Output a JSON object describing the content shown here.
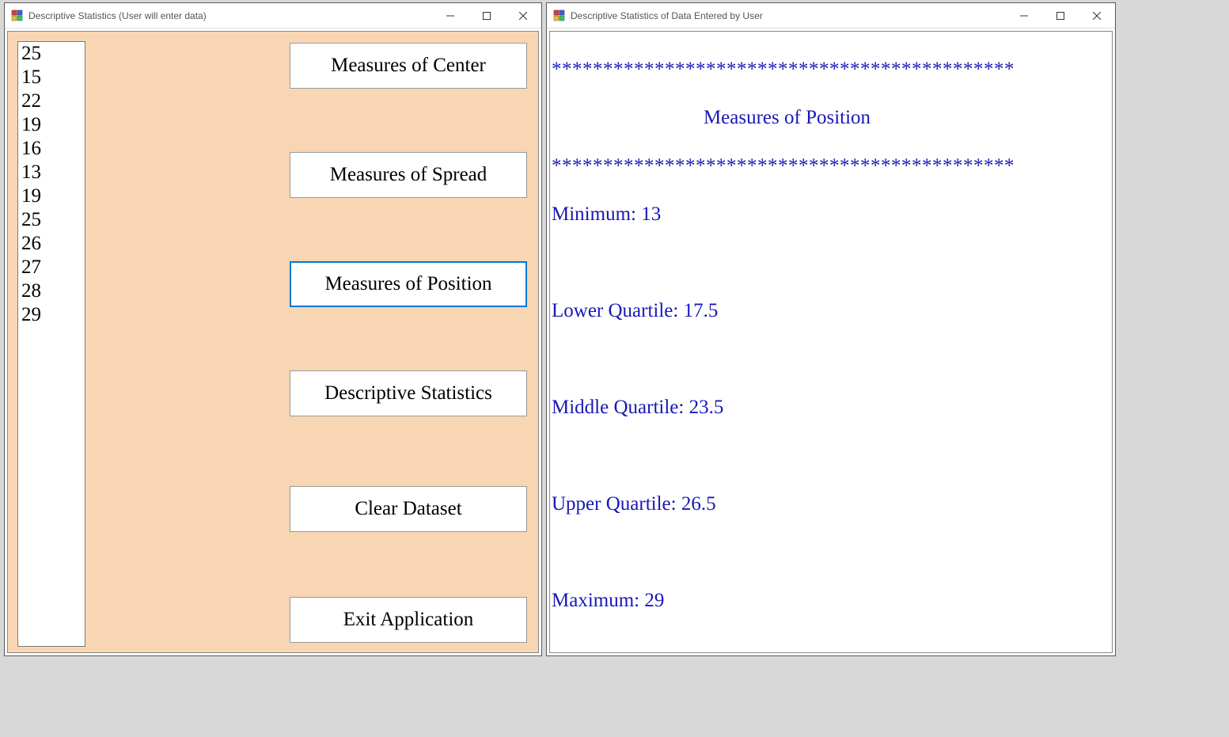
{
  "windows": {
    "left": {
      "title": "Descriptive Statistics (User will enter data)"
    },
    "right": {
      "title": "Descriptive Statistics of Data Entered by User"
    }
  },
  "dataset": {
    "values": [
      "25",
      "15",
      "22",
      "19",
      "16",
      "13",
      "19",
      "25",
      "26",
      "27",
      "28",
      "29"
    ]
  },
  "buttons": {
    "measures_center": "Measures of Center",
    "measures_spread": "Measures of Spread",
    "measures_position": "Measures of Position",
    "descriptive_stats": "Descriptive Statistics",
    "clear_dataset": "Clear Dataset",
    "exit_application": "Exit Application"
  },
  "output": {
    "asterisks": "*********************************************",
    "heading": "Measures of Position",
    "lines": {
      "minimum": "Minimum: 13",
      "lower_quartile": "Lower Quartile: 17.5",
      "middle_quartile": "Middle Quartile: 23.5",
      "upper_quartile": "Upper Quartile: 26.5",
      "maximum": "Maximum: 29"
    }
  }
}
